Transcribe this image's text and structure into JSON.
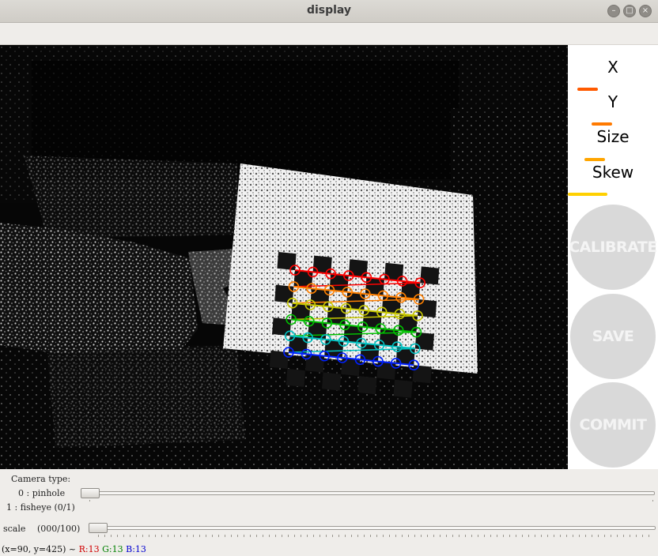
{
  "window": {
    "title": "display"
  },
  "window_buttons": {
    "minimize": "–",
    "maximize": "□",
    "close": "×"
  },
  "panel": {
    "metrics": [
      {
        "label": "X",
        "progress": 0.22,
        "color": "#ff5a00"
      },
      {
        "label": "Y",
        "progress": 0.38,
        "color": "#ff7a00"
      },
      {
        "label": "Size",
        "progress": 0.3,
        "color": "#ffa500"
      },
      {
        "label": "Skew",
        "progress": 0.45,
        "color": "#ffd000"
      }
    ],
    "buttons": {
      "calibrate": "CALIBRATE",
      "save": "SAVE",
      "commit": "COMMIT"
    }
  },
  "controls": {
    "camera_type_label": "Camera type:",
    "option_pinhole": "0 : pinhole",
    "option_fisheye": "1 : fisheye (0/1)",
    "camera_type_value": 0,
    "scale_label": "scale",
    "scale_value": "(000/100)"
  },
  "status": {
    "coords": "(x=90, y=425) ~",
    "r": "R:13",
    "g": "G:13",
    "b": "B:13",
    "r_color": "#d00000",
    "g_color": "#008000",
    "b_color": "#0000d0"
  },
  "checkerboard": {
    "row_colors": [
      "#ff0000",
      "#ff8000",
      "#c8c800",
      "#00c000",
      "#00c0c0",
      "#0020ff"
    ]
  }
}
